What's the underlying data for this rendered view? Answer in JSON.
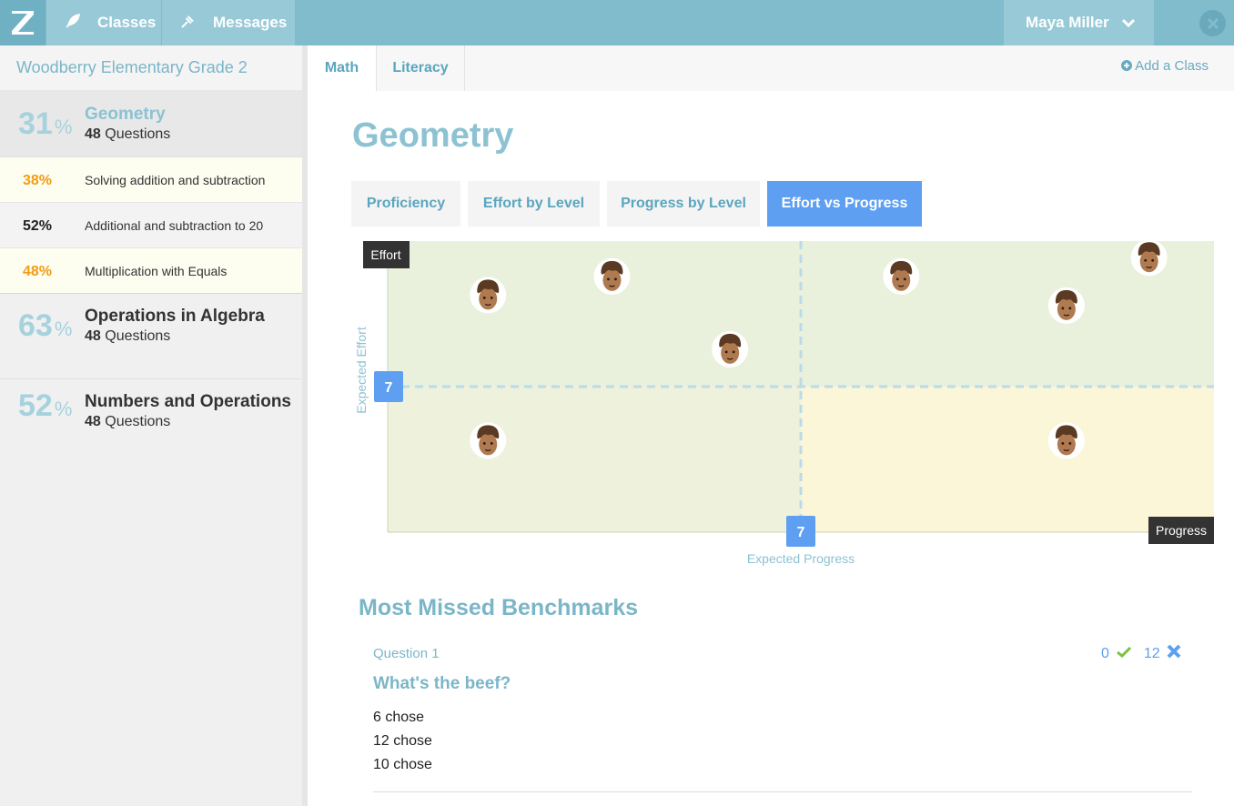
{
  "app": {
    "logo_letter": "Z"
  },
  "nav": {
    "classes_label": "Classes",
    "messages_label": "Messages",
    "user_name": "Maya Miller"
  },
  "sidebar": {
    "school": "Woodberry Elementary Grade 2",
    "categories": [
      {
        "pct": "31",
        "unit": "%",
        "name": "Geometry",
        "count": "48",
        "count_label": "Questions",
        "subs": [
          {
            "pct": "38%",
            "label": "Solving addition and subtraction",
            "color": "#f39c12"
          },
          {
            "pct": "52%",
            "label": "Additional and subtraction to 20",
            "color": "#222222"
          },
          {
            "pct": "48%",
            "label": "Multiplication with Equals",
            "color": "#f39c12"
          }
        ]
      },
      {
        "pct": "63",
        "unit": "%",
        "name": "Operations in Algebra",
        "count": "48",
        "count_label": "Questions"
      },
      {
        "pct": "52",
        "unit": "%",
        "name": "Numbers and Operations",
        "count": "48",
        "count_label": "Questions"
      }
    ]
  },
  "class_tabs": {
    "math": "Math",
    "literacy": "Literacy",
    "add_class": "Add a Class"
  },
  "page_title": "Geometry",
  "report_tabs": {
    "proficiency": "Proficiency",
    "effort_by_level": "Effort by Level",
    "progress_by_level": "Progress by Level",
    "effort_vs_progress": "Effort vs Progress"
  },
  "chart_data": {
    "type": "scatter",
    "x_axis_label": "Progress",
    "y_axis_label": "Effort",
    "expected_x_label": "Expected Progress",
    "expected_y_label": "Expected Effort",
    "expected_x": 7,
    "expected_y": 7,
    "xlim": [
      0,
      14
    ],
    "ylim": [
      0,
      14
    ],
    "points": [
      {
        "x": 1.7,
        "y": 11.4
      },
      {
        "x": 3.8,
        "y": 12.3
      },
      {
        "x": 5.8,
        "y": 8.8
      },
      {
        "x": 8.7,
        "y": 12.3
      },
      {
        "x": 11.5,
        "y": 10.9
      },
      {
        "x": 12.9,
        "y": 13.2
      },
      {
        "x": 1.7,
        "y": 4.4
      },
      {
        "x": 11.5,
        "y": 4.4
      }
    ],
    "colors": {
      "quadrant_high": "#e9f1dc",
      "quadrant_low_left": "#eef2dc",
      "quadrant_low_right": "#fbf6d8",
      "marker": "#5e9ff1",
      "dash": "#bcdbe8"
    }
  },
  "benchmarks": {
    "title": "Most Missed Benchmarks",
    "question_label": "Question 1",
    "correct_count": "0",
    "wrong_count": "12",
    "question_title": "What's the beef?",
    "answers": [
      "6 chose",
      "12 chose",
      "10 chose"
    ]
  }
}
